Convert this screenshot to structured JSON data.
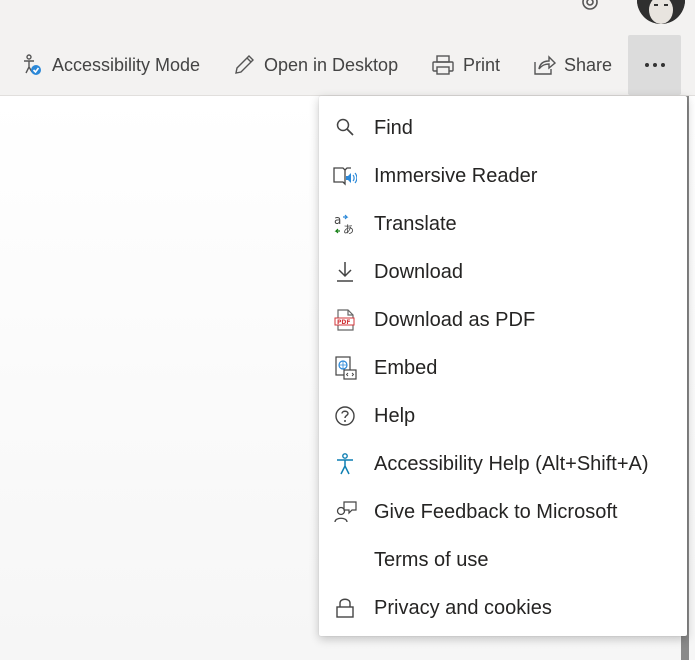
{
  "toolbar": {
    "accessibility_mode": "Accessibility Mode",
    "open_in_desktop": "Open in Desktop",
    "print": "Print",
    "share": "Share",
    "more_icon": "ellipsis-icon"
  },
  "menu": {
    "items": [
      {
        "label": "Find",
        "icon": "search-icon"
      },
      {
        "label": "Immersive Reader",
        "icon": "immersive-reader-icon"
      },
      {
        "label": "Translate",
        "icon": "translate-icon"
      },
      {
        "label": "Download",
        "icon": "download-icon"
      },
      {
        "label": "Download as PDF",
        "icon": "pdf-icon"
      },
      {
        "label": "Embed",
        "icon": "embed-icon"
      },
      {
        "label": "Help",
        "icon": "help-icon"
      },
      {
        "label": "Accessibility Help (Alt+Shift+A)",
        "icon": "accessibility-icon"
      },
      {
        "label": "Give Feedback to Microsoft",
        "icon": "feedback-icon"
      },
      {
        "label": "Terms of use",
        "icon": ""
      },
      {
        "label": "Privacy and cookies",
        "icon": "lock-icon"
      }
    ]
  },
  "colors": {
    "accent_blue": "#2b88d8",
    "accessibility_teal": "#0f7fb3",
    "pdf_red": "#d13438",
    "icon_gray": "#444444"
  }
}
